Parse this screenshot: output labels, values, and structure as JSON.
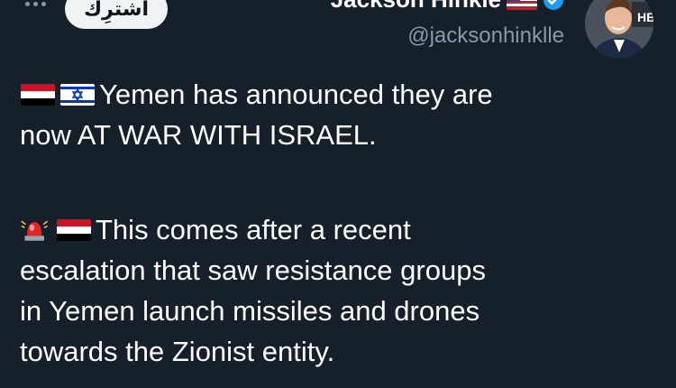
{
  "header": {
    "follow_button_label": "اشترِك",
    "display_name": "Jackson Hinkle",
    "handle": "@jacksonhinklle",
    "menu_icon": "more-options-icon",
    "verified_icon": "verified-badge-icon",
    "name_flag_icon": "us-flag-icon",
    "avatar_icon": "profile-avatar"
  },
  "tweet": {
    "paragraph1": {
      "icons": [
        "yemen-flag-icon",
        "israel-flag-icon"
      ],
      "line1": "Yemen has announced they are",
      "line2": "now AT WAR WITH ISRAEL."
    },
    "paragraph2": {
      "icons": [
        "police-light-icon",
        "yemen-flag-icon"
      ],
      "line1": "This comes after a recent",
      "line2": "escalation that saw resistance groups",
      "line3": "in Yemen launch missiles and drones",
      "line4": "towards the Zionist entity."
    }
  },
  "colors": {
    "background": "#15202b",
    "text": "#ffffff",
    "secondary_text": "#8b98a5",
    "follow_button_bg": "#eff3f4",
    "verified_blue": "#1d9bf0"
  }
}
